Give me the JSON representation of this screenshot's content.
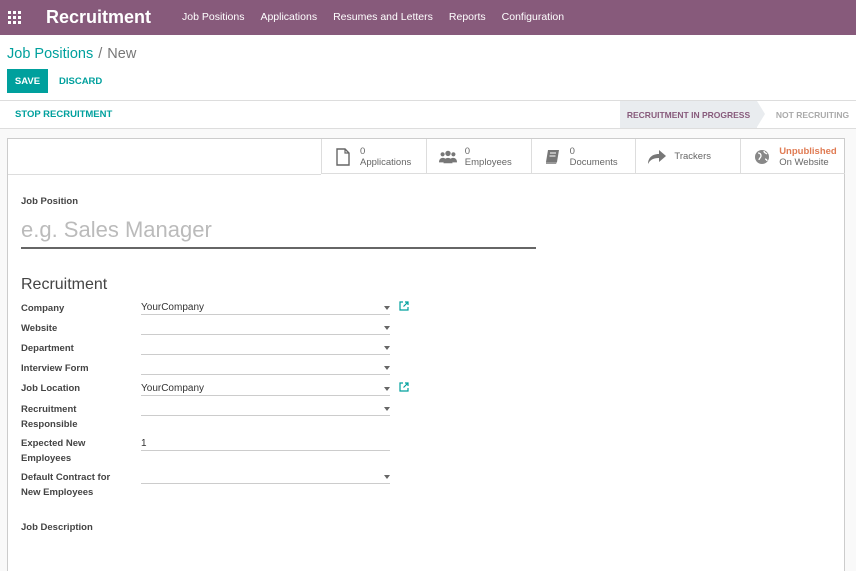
{
  "navbar": {
    "app_title": "Recruitment",
    "menu": [
      "Job Positions",
      "Applications",
      "Resumes and Letters",
      "Reports",
      "Configuration"
    ]
  },
  "breadcrumb": {
    "parent": "Job Positions",
    "separator": "/",
    "current": "New"
  },
  "actions": {
    "save": "SAVE",
    "discard": "DISCARD"
  },
  "statusbar": {
    "stop_recruitment": "STOP RECRUITMENT",
    "stage_active": "RECRUITMENT IN PROGRESS",
    "stage_inactive": "NOT RECRUITING"
  },
  "smart_buttons": [
    {
      "icon": "file-icon",
      "count": "0",
      "label": "Applications"
    },
    {
      "icon": "users-icon",
      "count": "0",
      "label": "Employees"
    },
    {
      "icon": "book-icon",
      "count": "0",
      "label": "Documents"
    },
    {
      "icon": "share-icon",
      "label": "Trackers"
    },
    {
      "icon": "globe-icon",
      "status": "Unpublished",
      "label": "On Website"
    }
  ],
  "form": {
    "job_position_label": "Job Position",
    "job_position_placeholder": "e.g. Sales Manager",
    "section_title": "Recruitment",
    "fields": {
      "company": {
        "label": "Company",
        "value": "YourCompany"
      },
      "website": {
        "label": "Website",
        "value": ""
      },
      "department": {
        "label": "Department",
        "value": ""
      },
      "interview_form": {
        "label": "Interview Form",
        "value": ""
      },
      "job_location": {
        "label": "Job Location",
        "value": "YourCompany"
      },
      "recruitment_responsible": {
        "label_line1": "Recruitment",
        "label_line2": "Responsible",
        "value": ""
      },
      "expected_new_employees": {
        "label_line1": "Expected New",
        "label_line2": "Employees",
        "value": "1"
      },
      "default_contract": {
        "label_line1": "Default Contract for",
        "label_line2": "New Employees",
        "value": ""
      }
    },
    "job_description_label": "Job Description"
  },
  "colors": {
    "brand": "#875a7b",
    "accent": "#00a09d",
    "unpublished": "#e07b53"
  }
}
